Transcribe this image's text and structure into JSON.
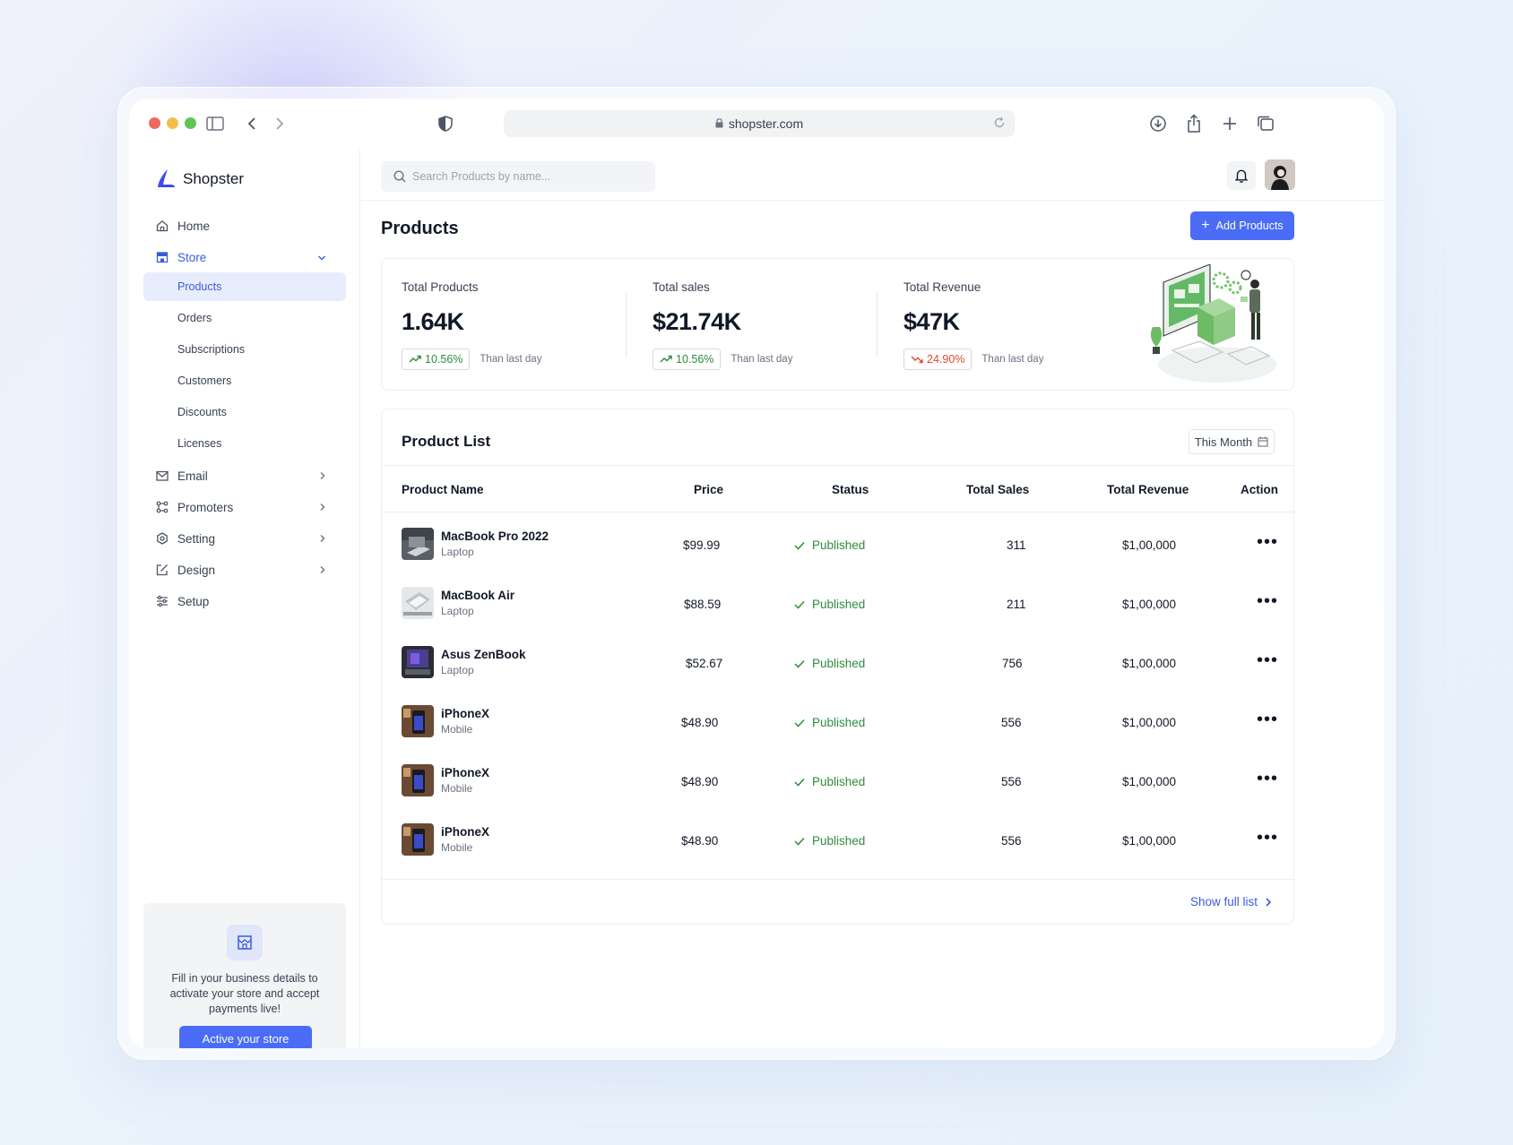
{
  "browser": {
    "url": "shopster.com"
  },
  "brand": {
    "name": "Shopster"
  },
  "sidebar": {
    "nav": [
      {
        "label": "Home",
        "icon": "home-icon"
      },
      {
        "label": "Store",
        "icon": "store-icon",
        "expanded": true
      }
    ],
    "store_items": [
      "Products",
      "Orders",
      "Subscriptions",
      "Customers",
      "Discounts",
      "Licenses"
    ],
    "nav_bottom": [
      {
        "label": "Email",
        "icon": "mail-icon"
      },
      {
        "label": "Promoters",
        "icon": "promoters-icon"
      },
      {
        "label": "Setting",
        "icon": "settings-icon"
      },
      {
        "label": "Design",
        "icon": "design-icon"
      },
      {
        "label": "Setup",
        "icon": "sliders-icon"
      }
    ],
    "promo": {
      "text": "Fill in your business details to activate your store and accept payments live!",
      "button": "Active your store"
    }
  },
  "topbar": {
    "search_placeholder": "Search Products by name..."
  },
  "page": {
    "title": "Products",
    "add_button": "Add Products"
  },
  "stats": [
    {
      "label": "Total Products",
      "value": "1.64K",
      "change": "10.56%",
      "trend": "up",
      "note": "Than last day"
    },
    {
      "label": "Total sales",
      "value": "$21.74K",
      "change": "10.56%",
      "trend": "up",
      "note": "Than last day"
    },
    {
      "label": "Total Revenue",
      "value": "$47K",
      "change": "24.90%",
      "trend": "down",
      "note": "Than last day"
    }
  ],
  "product_list": {
    "title": "Product List",
    "filter": "This Month",
    "columns": [
      "Product Name",
      "Price",
      "Status",
      "Total Sales",
      "Total Revenue",
      "Action"
    ],
    "rows": [
      {
        "name": "MacBook Pro 2022",
        "category": "Laptop",
        "price": "$99.99",
        "status": "Published",
        "sales": "311",
        "revenue": "$1,00,000"
      },
      {
        "name": "MacBook Air",
        "category": "Laptop",
        "price": "$88.59",
        "status": "Published",
        "sales": "211",
        "revenue": "$1,00,000"
      },
      {
        "name": "Asus ZenBook",
        "category": "Laptop",
        "price": "$52.67",
        "status": "Published",
        "sales": "756",
        "revenue": "$1,00,000"
      },
      {
        "name": "iPhoneX",
        "category": "Mobile",
        "price": "$48.90",
        "status": "Published",
        "sales": "556",
        "revenue": "$1,00,000"
      },
      {
        "name": "iPhoneX",
        "category": "Mobile",
        "price": "$48.90",
        "status": "Published",
        "sales": "556",
        "revenue": "$1,00,000"
      },
      {
        "name": "iPhoneX",
        "category": "Mobile",
        "price": "$48.90",
        "status": "Published",
        "sales": "556",
        "revenue": "$1,00,000"
      }
    ],
    "show_full": "Show full list"
  },
  "colors": {
    "accent": "#4a6cf7",
    "accent_text": "#3b5bdb",
    "up": "#2e8b3d",
    "down": "#e0482f"
  }
}
